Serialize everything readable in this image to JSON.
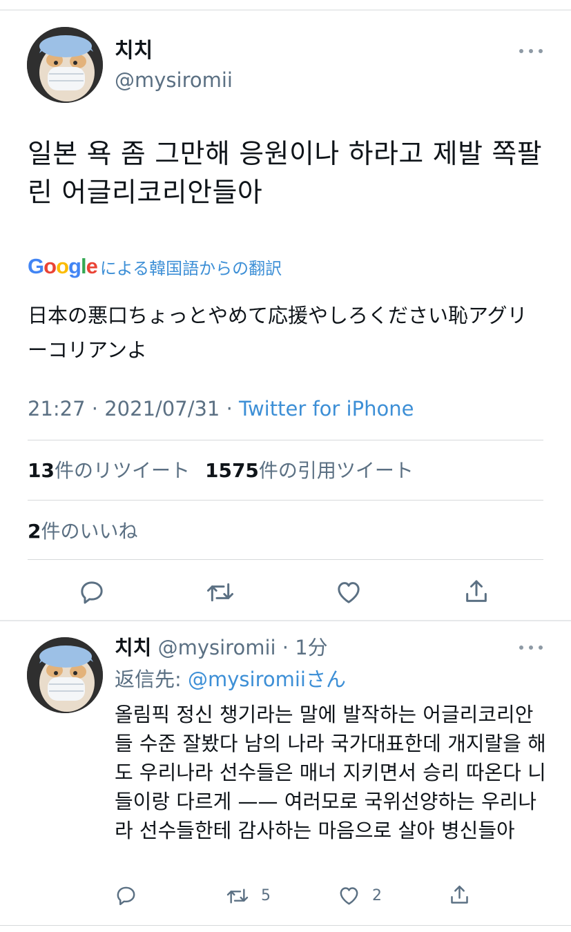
{
  "main_tweet": {
    "display_name": "치치",
    "handle": "@mysiromii",
    "text": "일본 욕 좀 그만해 응원이나 하라고 제발 쪽팔린 어글리코리안들아",
    "translation": {
      "provider": "Google",
      "label": "による韓国語からの翻訳",
      "text": "日本の悪口ちょっとやめて応援やしろください恥アグリーコリアンよ"
    },
    "time": "21:27",
    "date": "2021/07/31",
    "source": "Twitter for iPhone",
    "retweets_count": "13",
    "retweets_label": "件のリツイート",
    "quotes_count": "1575",
    "quotes_label": "件の引用ツイート",
    "likes_count": "2",
    "likes_label": "件のいいね"
  },
  "reply_tweet": {
    "display_name": "치치",
    "handle": "@mysiromii",
    "time_ago": "1分",
    "reply_prefix": "返信先: ",
    "reply_mention": "@mysiromii",
    "reply_suffix": "さん",
    "text": "올림픽 정신 챙기라는 말에 발작하는 어글리코리안들 수준 잘봤다 남의 나라 국가대표한데 개지랄을 해도 우리나라 선수들은 매너 지키면서 승리 따온다 니들이랑 다르게 —— 여러모로 국위선양하는 우리나라 선수들한테 감사하는 마음으로 살아 병신들아",
    "retweets": "5",
    "likes": "2"
  },
  "icons": {
    "reply": "speech-bubble-icon",
    "retweet": "retweet-arrows-icon",
    "like": "heart-icon",
    "share": "share-upload-icon",
    "more": "more-dots-icon"
  },
  "colors": {
    "link": "#3d8fd6",
    "muted": "#5b7083",
    "text": "#0f1419",
    "divider": "#d6d9db"
  }
}
